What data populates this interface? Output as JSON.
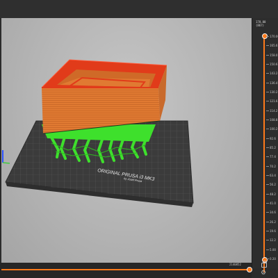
{
  "viewport": {
    "bed_label": "ORIGINAL PRUSA i3 MK3",
    "bed_sublabel": "by Josef Prusa",
    "colors": {
      "perimeter": "#e13b1a",
      "infill": "#e07a32",
      "support": "#3ee02c",
      "bed": "#3a3a3a"
    }
  },
  "layer_slider": {
    "top_value": "170.00",
    "top_index": "(867)",
    "ticks": [
      "170.00",
      "165.6",
      "158.0",
      "150.6",
      "143.2",
      "136.4",
      "130.2",
      "121.6",
      "114.2",
      "108.8",
      "100.2",
      "92.6",
      "85.2",
      "77.4",
      "70.2",
      "63.4",
      "56.2",
      "48.2",
      "41.0",
      "34.6",
      "26.2",
      "19.6",
      "12.2",
      "5.00",
      "0.20"
    ],
    "lock_icon": "lock-icon",
    "settings_icon": "gear-icon"
  },
  "move_slider": {
    "label": "2140852"
  }
}
